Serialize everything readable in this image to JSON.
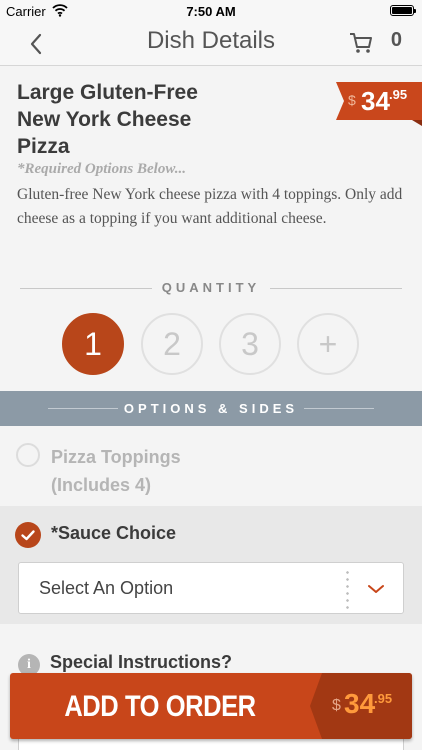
{
  "status_bar": {
    "carrier": "Carrier",
    "time": "7:50 AM"
  },
  "navbar": {
    "title": "Dish Details",
    "cart_count": "0"
  },
  "dish": {
    "title": "Large Gluten-Free New York Cheese Pizza",
    "price": {
      "currency": "$",
      "whole": "34",
      "cents": ".95"
    },
    "required_note": "*Required Options Below...",
    "description": "Gluten-free New York cheese pizza with 4 toppings. Only add cheese as a topping if you want additional cheese."
  },
  "quantity": {
    "label": "QUANTITY",
    "options": [
      "1",
      "2",
      "3",
      "+"
    ],
    "selected": "1"
  },
  "options_sides": {
    "label": "OPTIONS & SIDES"
  },
  "toppings": {
    "label_line1": "Pizza Toppings",
    "label_line2": "(Includes 4)"
  },
  "sauce": {
    "label": "*Sauce Choice",
    "select_text": "Select An Option"
  },
  "special": {
    "label": "Special Instructions?",
    "info_icon_text": "i"
  },
  "add_to_order": {
    "label": "ADD TO ORDER",
    "price": {
      "currency": "$",
      "whole": "34",
      "cents": ".95"
    }
  },
  "colors": {
    "accent": "#c8461a",
    "options_bar": "#8c9aa6",
    "price_highlight": "#ff9a3c"
  },
  "icons": [
    "wifi-icon",
    "battery-icon",
    "back-chevron-icon",
    "cart-icon",
    "checkmark-icon",
    "chevron-down-icon",
    "info-icon"
  ]
}
